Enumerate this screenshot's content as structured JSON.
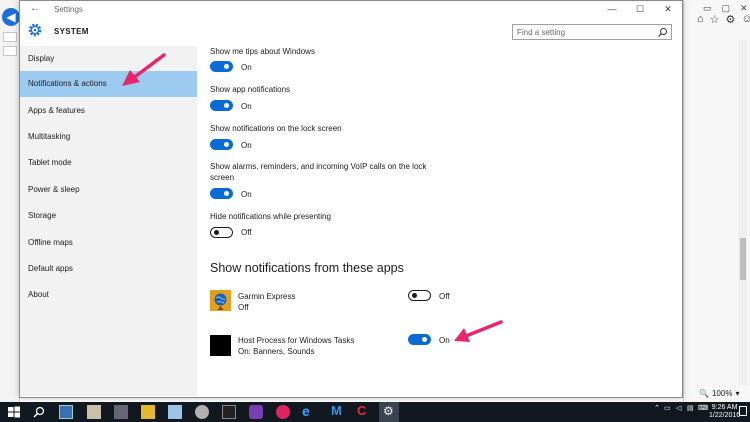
{
  "window": {
    "title": "Settings",
    "back_glyph": "←",
    "minimize_glyph": "—",
    "maximize_glyph": "☐",
    "close_glyph": "✕"
  },
  "header": {
    "section_title": "SYSTEM",
    "search_placeholder": "Find a setting"
  },
  "sidebar": {
    "items": [
      {
        "label": "Display"
      },
      {
        "label": "Notifications & actions",
        "selected": true
      },
      {
        "label": "Apps & features"
      },
      {
        "label": "Multitasking"
      },
      {
        "label": "Tablet mode"
      },
      {
        "label": "Power & sleep"
      },
      {
        "label": "Storage"
      },
      {
        "label": "Offline maps"
      },
      {
        "label": "Default apps"
      },
      {
        "label": "About"
      }
    ]
  },
  "settings": [
    {
      "label": "Show me tips about Windows",
      "state": "On"
    },
    {
      "label": "Show app notifications",
      "state": "On"
    },
    {
      "label": "Show notifications on the lock screen",
      "state": "On"
    },
    {
      "label_line1": "Show alarms, reminders, and incoming VoIP calls on the lock",
      "label_line2": "screen",
      "state": "On"
    },
    {
      "label": "Hide notifications while presenting",
      "state": "Off"
    }
  ],
  "apps_section": {
    "heading": "Show notifications from these apps",
    "apps": [
      {
        "name": "Garmin Express",
        "status": "Off",
        "state": "Off",
        "icon": "garmin-globe-icon"
      },
      {
        "name": "Host Process for Windows Tasks",
        "status": "On: Banners, Sounds",
        "state": "On",
        "icon": "host-process-icon"
      }
    ]
  },
  "taskbar": {
    "time": "9:26 AM",
    "date": "1/22/2016",
    "zoom": "100%"
  },
  "colors": {
    "accent": "#0a6ad6",
    "selected_nav": "#9ccaf0",
    "sidebar_bg": "#f2f2f2",
    "arrow": "#e8266b",
    "taskbar": "#111820"
  }
}
